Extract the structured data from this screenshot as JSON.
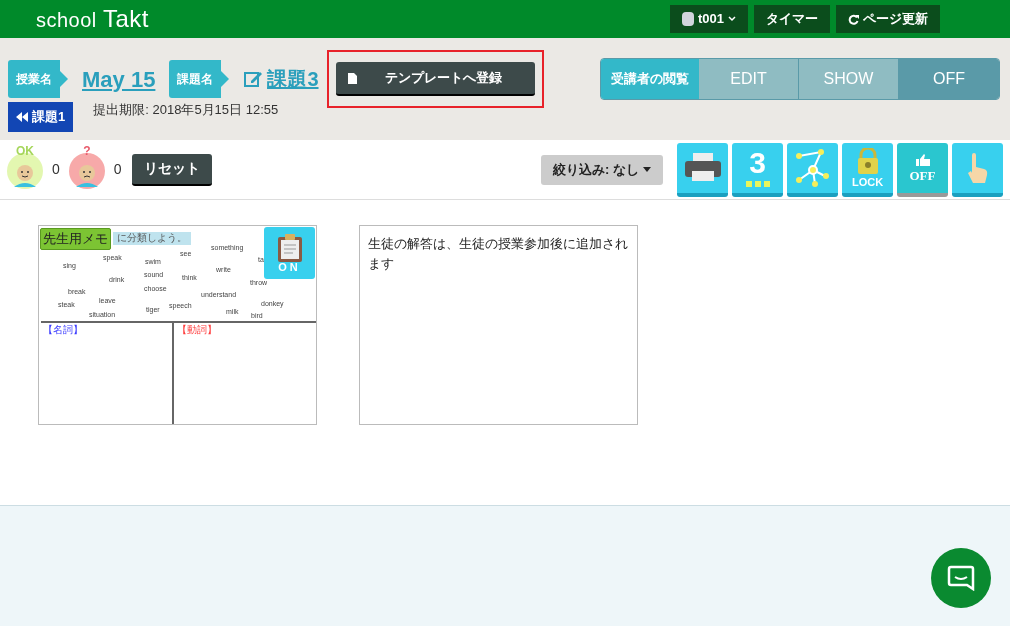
{
  "header": {
    "logo_left": "school",
    "logo_right": "Takt",
    "user": "t001",
    "timer": "タイマー",
    "refresh": "ページ更新"
  },
  "lesson": {
    "label": "授業名",
    "name": "May 15"
  },
  "task": {
    "label": "課題名",
    "name": "課題3",
    "back": "課題1",
    "deadline": "提出期限: 2018年5月15日 12:55"
  },
  "template_button": "テンプレートへ登録",
  "viewer_mode": {
    "label": "受講者の閲覧",
    "options": [
      {
        "label": "EDIT",
        "selected": false
      },
      {
        "label": "SHOW",
        "selected": false
      },
      {
        "label": "OFF",
        "selected": true
      }
    ]
  },
  "counts": [
    {
      "kind": "ok",
      "badge": "OK",
      "count": "0"
    },
    {
      "kind": "question",
      "badge": "?",
      "count": "0"
    }
  ],
  "reset": "リセット",
  "filter": "絞り込み: なし",
  "tools": [
    {
      "kind": "print"
    },
    {
      "kind": "number",
      "text": "3"
    },
    {
      "kind": "network"
    },
    {
      "kind": "lock",
      "text": "LOCK"
    },
    {
      "kind": "like",
      "text": "OFF",
      "selected": true
    },
    {
      "kind": "hand"
    }
  ],
  "cards": [
    {
      "kind": "sheet",
      "memo": "先生用メモ",
      "memo_toggle": "ON",
      "instruction": "に分類しよう。",
      "words": [
        "sing",
        "speak",
        "swim",
        "see",
        "something",
        "ta",
        "drink",
        "sound",
        "think",
        "write",
        "throw",
        "break",
        "choose",
        "understand",
        "steak",
        "leave",
        "tiger",
        "speech",
        "milk",
        "donkey",
        "situation",
        "bird"
      ],
      "columns": [
        "【名詞】",
        "【動詞】"
      ]
    },
    {
      "kind": "note",
      "text": "生徒の解答は、生徒の授業参加後に追加されます"
    }
  ]
}
